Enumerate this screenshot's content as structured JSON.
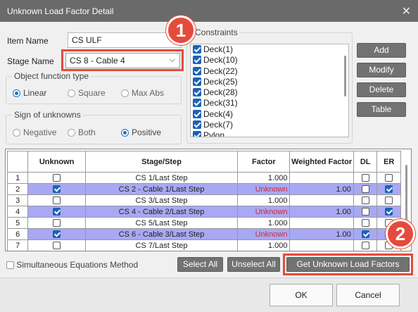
{
  "window": {
    "title": "Unknown Load Factor Detail",
    "close_glyph": "✕"
  },
  "item_name": {
    "label": "Item Name",
    "value": "CS ULF"
  },
  "stage_name": {
    "label": "Stage Name",
    "value": "CS 8 - Cable 4",
    "chevron": "⌵"
  },
  "object_function_type": {
    "title": "Object function type",
    "options": [
      "Linear",
      "Square",
      "Max Abs"
    ],
    "selected": "Linear"
  },
  "sign_of_unknowns": {
    "title": "Sign of unknowns",
    "options": [
      "Negative",
      "Both",
      "Positive"
    ],
    "selected": "Positive"
  },
  "constraints": {
    "title": "Constraints",
    "items": [
      "Deck(1)",
      "Deck(10)",
      "Deck(22)",
      "Deck(25)",
      "Deck(28)",
      "Deck(31)",
      "Deck(4)",
      "Deck(7)",
      "Pylon"
    ]
  },
  "side_buttons": {
    "add": "Add",
    "modify": "Modify",
    "delete": "Delete",
    "table": "Table"
  },
  "table": {
    "headers": [
      "Unknown",
      "Stage/Step",
      "Factor",
      "Weighted Factor",
      "DL",
      "ER"
    ],
    "rows": [
      {
        "n": "1",
        "unknown": false,
        "stage": "CS 1/Last Step",
        "factor": "1.000",
        "weighted": "",
        "dl": false,
        "er": false,
        "hl": false
      },
      {
        "n": "2",
        "unknown": true,
        "stage": "CS 2 - Cable 1/Last Step",
        "factor": "Unknown",
        "weighted": "1.00",
        "dl": false,
        "er": true,
        "hl": true
      },
      {
        "n": "3",
        "unknown": false,
        "stage": "CS 3/Last Step",
        "factor": "1.000",
        "weighted": "",
        "dl": false,
        "er": false,
        "hl": false
      },
      {
        "n": "4",
        "unknown": true,
        "stage": "CS 4 - Cable 2/Last Step",
        "factor": "Unknown",
        "weighted": "1.00",
        "dl": false,
        "er": true,
        "hl": true
      },
      {
        "n": "5",
        "unknown": false,
        "stage": "CS 5/Last Step",
        "factor": "1.000",
        "weighted": "",
        "dl": false,
        "er": false,
        "hl": false
      },
      {
        "n": "6",
        "unknown": true,
        "stage": "CS 6 - Cable 3/Last Step",
        "factor": "Unknown",
        "weighted": "1.00",
        "dl": true,
        "er": true,
        "hl": true
      },
      {
        "n": "7",
        "unknown": false,
        "stage": "CS 7/Last Step",
        "factor": "1.000",
        "weighted": "",
        "dl": false,
        "er": false,
        "hl": false
      }
    ]
  },
  "bottom": {
    "simultaneous": "Simultaneous Equations Method",
    "select_all": "Select All",
    "unselect_all": "Unselect All",
    "get_factors": "Get Unknown Load Factors",
    "ok": "OK",
    "cancel": "Cancel"
  },
  "callouts": {
    "one": "1",
    "two": "2"
  },
  "colors": {
    "accent": "#1c62b9",
    "callout": "#e54b3c",
    "highlight": "#a8a8f3",
    "unknown_text": "#d42a2a"
  }
}
